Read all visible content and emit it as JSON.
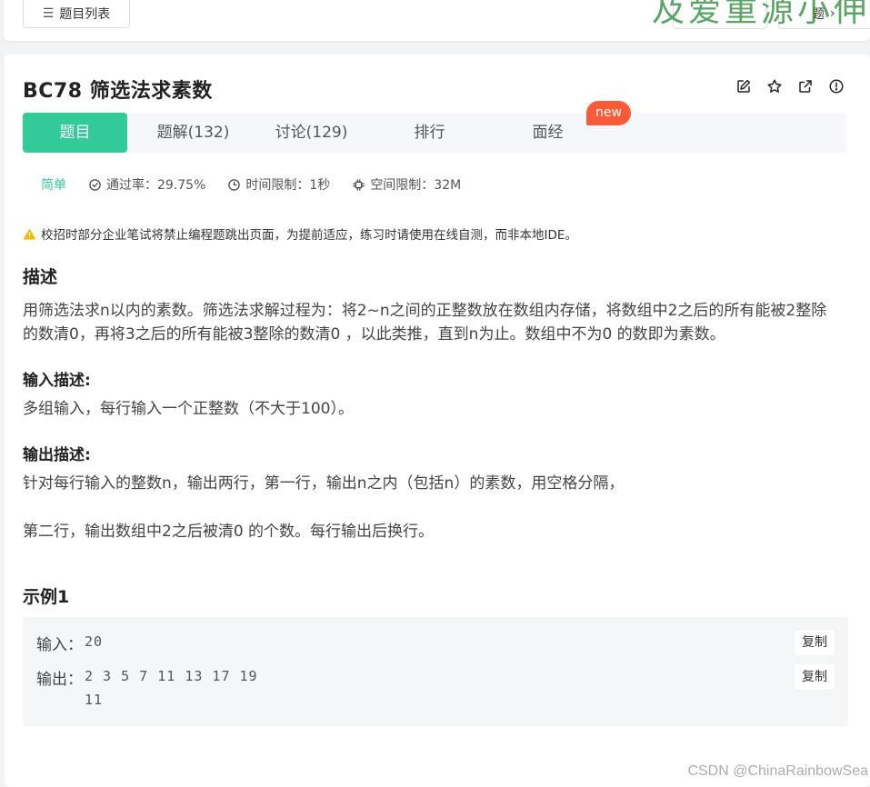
{
  "toolbar": {
    "list_label": "题目列表",
    "next_label": "题",
    "watermark": "及爱重源小伸"
  },
  "problem": {
    "title": "BC78  筛选法求素数"
  },
  "tabs": [
    {
      "label": "题目",
      "active": true
    },
    {
      "label": "题解(132)",
      "active": false
    },
    {
      "label": "讨论(129)",
      "active": false
    },
    {
      "label": "排行",
      "active": false
    },
    {
      "label": "面经",
      "active": false
    }
  ],
  "badge_new": "new",
  "meta": {
    "difficulty": "简单",
    "pass_rate": "通过率：29.75%",
    "time_limit": "时间限制：1秒",
    "space_limit": "空间限制：32M"
  },
  "warning": "校招时部分企业笔试将禁止编程题跳出页面，为提前适应，练习时请使用在线自测，而非本地IDE。",
  "description": {
    "heading": "描述",
    "line1": "用筛选法求n以内的素数。筛选法求解过程为：将2~n之间的正整数放在数组内存储，将数组中2之后的所有能被2整除",
    "line2": "的数清0，再将3之后的所有能被3整除的数清0 ，以此类推，直到n为止。数组中不为0 的数即为素数。"
  },
  "input_desc": {
    "heading": "输入描述:",
    "text": "多组输入，每行输入一个正整数（不大于100）。"
  },
  "output_desc": {
    "heading": "输出描述:",
    "line1": "针对每行输入的整数n，输出两行，第一行，输出n之内（包括n）的素数，用空格分隔，",
    "line2": "第二行，输出数组中2之后被清0 的个数。每行输出后换行。"
  },
  "example": {
    "heading": "示例1",
    "input_label": "输入：",
    "input_value": "20",
    "output_label": "输出：",
    "output_line1": "2 3 5 7 11 13 17 19",
    "output_line2": "11",
    "copy_label": "复制"
  },
  "watermark_bottom": "CSDN @ChinaRainbowSea",
  "colors": {
    "accent": "#32ca99",
    "new_badge": "#fa5a36",
    "warning": "#f5b800"
  }
}
